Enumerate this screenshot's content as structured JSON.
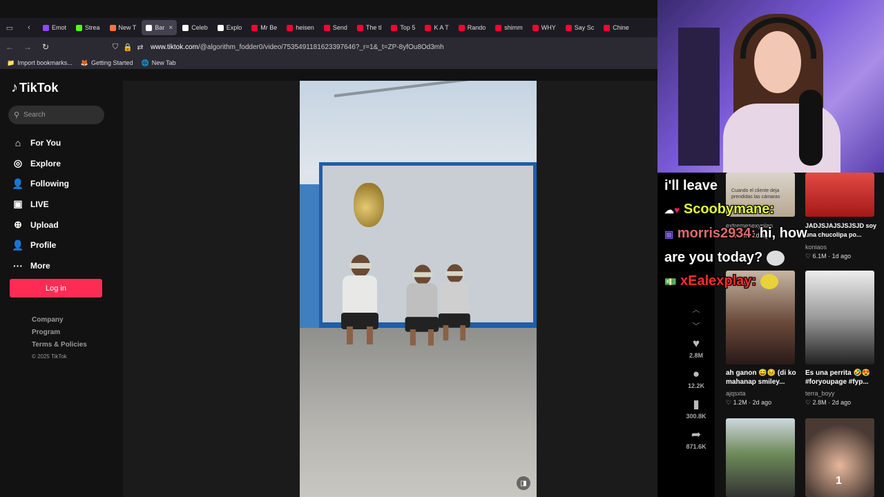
{
  "browser": {
    "tabs": [
      {
        "label": "Emot",
        "color": "#9146ff"
      },
      {
        "label": "Strea",
        "color": "#53fc18"
      },
      {
        "label": "New T",
        "color": "#ff7139"
      },
      {
        "label": "Bar",
        "color": "#ffffff",
        "active": true
      },
      {
        "label": "Celeb",
        "color": "#ffffff"
      },
      {
        "label": "Explo",
        "color": "#ffffff"
      },
      {
        "label": "Mr Be",
        "color": "#ff0033"
      },
      {
        "label": "heisen",
        "color": "#ff0033"
      },
      {
        "label": "Send",
        "color": "#ff0033"
      },
      {
        "label": "The tl",
        "color": "#ff0033"
      },
      {
        "label": "Top 5",
        "color": "#ff0033"
      },
      {
        "label": "K A T",
        "color": "#ff0033"
      },
      {
        "label": "Rando",
        "color": "#ff0033"
      },
      {
        "label": "shimm",
        "color": "#ff0033"
      },
      {
        "label": "WHY",
        "color": "#ff0033"
      },
      {
        "label": "Say Sc",
        "color": "#ff0033"
      },
      {
        "label": "Chine",
        "color": "#ff0033"
      }
    ],
    "url_host": "www.tiktok.com",
    "url_path": "/@algorithm_fodder0/video/7535491181623397646?_r=1&_t=ZP-8yfOu8Od3mh",
    "bookmarks": [
      {
        "label": "Import bookmarks...",
        "icon": "📁"
      },
      {
        "label": "Getting Started",
        "icon": "🦊"
      },
      {
        "label": "New Tab",
        "icon": "🌐"
      }
    ]
  },
  "tiktok": {
    "logo": "TikTok",
    "search_placeholder": "Search",
    "nav": [
      {
        "label": "For You",
        "icon": "⌂"
      },
      {
        "label": "Explore",
        "icon": "◎"
      },
      {
        "label": "Following",
        "icon": "👤"
      },
      {
        "label": "LIVE",
        "icon": "▣"
      },
      {
        "label": "Upload",
        "icon": "⊕"
      },
      {
        "label": "Profile",
        "icon": "👤"
      },
      {
        "label": "More",
        "icon": "···"
      }
    ],
    "login_label": "Log in",
    "footer": [
      "Company",
      "Program",
      "Terms & Policies"
    ],
    "copyright": "© 2025 TikTok",
    "actions": [
      {
        "icon": "♥",
        "count": "2.8M"
      },
      {
        "icon": "●",
        "count": "12.2K"
      },
      {
        "icon": "▮",
        "count": "300.8K"
      },
      {
        "icon": "➦",
        "count": "871.6K"
      }
    ]
  },
  "side_grid": {
    "top_left": {
      "overlay": "Cuando el cliente deja prendidas las cámaras",
      "user": "extremesexyplan",
      "stats": "♡ 1.4M · 1d ago"
    },
    "top_right": {
      "caption": "JADJSJAJSJSJSJD soy una chucolipa po...",
      "user": "koniaos",
      "stats": "♡ 6.1M · 1d ago"
    },
    "mid_left": {
      "caption": "ah ganon 😅😣 (di ko mahanap smiley...",
      "user": "ajqsxta",
      "stats": "♡ 1.2M · 2d ago"
    },
    "mid_right": {
      "caption": "Es una perrita 🤣😍 #foryoupage #fyp...",
      "user": "terra_boyy",
      "stats": "♡ 2.8M · 2d ago"
    },
    "bottom_right_num": "1"
  },
  "chat": {
    "line1": "i'll leave",
    "user1": "Scoobymane:",
    "user2": "morris2934:",
    "msg2a": "hi, how",
    "msg2b": "are you today?",
    "user3": "xEalexplay:",
    "user1_color": "#e4ff3a",
    "user2_color": "#e06a6a",
    "user3_color": "#ff2a2a"
  }
}
